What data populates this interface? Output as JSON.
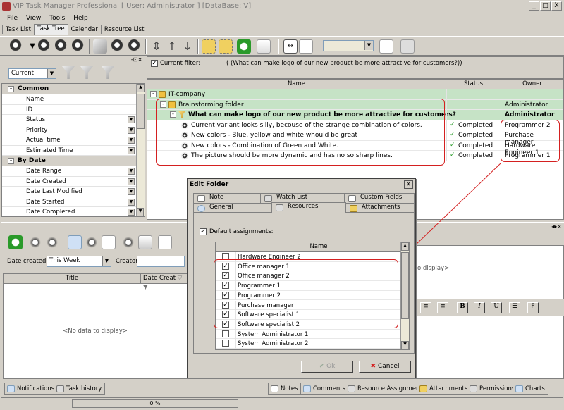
{
  "window": {
    "title": "VIP Task Manager Professional [ User: Administrator ] [DataBase: V]",
    "min": "_",
    "max": "□",
    "close": "X"
  },
  "menu": [
    "File",
    "View",
    "Tools",
    "Help"
  ],
  "tabs": [
    "Task List",
    "Task Tree",
    "Calendar",
    "Resource List"
  ],
  "left_panel": {
    "filter_value": "Current",
    "groups": [
      {
        "name": "Common",
        "toggle": "-",
        "rows": [
          {
            "label": "Name",
            "dropdown": false
          },
          {
            "label": "ID",
            "dropdown": false
          },
          {
            "label": "Status",
            "dropdown": true
          },
          {
            "label": "Priority",
            "dropdown": true
          },
          {
            "label": "Actual time",
            "dropdown": true
          },
          {
            "label": "Estimated Time",
            "dropdown": true
          }
        ]
      },
      {
        "name": "By Date",
        "toggle": "-",
        "rows": [
          {
            "label": "Date Range",
            "dropdown": true
          },
          {
            "label": "Date Created",
            "dropdown": true
          },
          {
            "label": "Date Last Modified",
            "dropdown": true
          },
          {
            "label": "Date Started",
            "dropdown": true
          },
          {
            "label": "Date Completed",
            "dropdown": true
          }
        ]
      }
    ]
  },
  "filter_bar": {
    "label": "Current filter:",
    "value": "( (What can make logo of our new product be more attractive for customers?))"
  },
  "tree": {
    "headers": {
      "name": "Name",
      "status": "Status",
      "owner": "Owner"
    },
    "rows": [
      {
        "name": "IT-company",
        "status": "",
        "owner": ""
      },
      {
        "name": "Brainstorming folder",
        "status": "",
        "owner": "Administrator"
      },
      {
        "name": "What can make logo of our new product be more attractive for customers?",
        "status": "",
        "owner": "Administrator"
      },
      {
        "name": "Current variant looks silly, becouse of the strange combination of colors.",
        "status": "Completed",
        "owner": "Programmer 2"
      },
      {
        "name": "New colors - Blue, yellow and white whould be great",
        "status": "Completed",
        "owner": "Purchase manager"
      },
      {
        "name": "New colors - Combination of Green and White.",
        "status": "Completed",
        "owner": "Hardware Engineer 1"
      },
      {
        "name": "The picture should be more dynamic and has no so sharp lines.",
        "status": "Completed",
        "owner": "Programmer 1"
      }
    ]
  },
  "lower_left": {
    "date_created_label": "Date created:",
    "date_created_value": "This Week",
    "creator_label": "Creator:",
    "col_title": "Title",
    "col_date": "Date Creat",
    "empty": "<No data to display>"
  },
  "lower_right": {
    "empty_partial": "o display>"
  },
  "dialog": {
    "title": "Edit Folder",
    "close": "X",
    "tabs_row1": [
      "Note",
      "Watch List",
      "Custom Fields"
    ],
    "tabs_row2": [
      "General",
      "Resources",
      "Attachments"
    ],
    "default_assignments": "Default assignments:",
    "list_header": "Name",
    "resources": [
      {
        "name": "Hardware Engineer 2",
        "checked": false
      },
      {
        "name": "Office manager 1",
        "checked": true
      },
      {
        "name": "Office manager 2",
        "checked": true
      },
      {
        "name": "Programmer 1",
        "checked": true
      },
      {
        "name": "Programmer 2",
        "checked": true
      },
      {
        "name": "Purchase manager",
        "checked": true
      },
      {
        "name": "Software specialist 1",
        "checked": true
      },
      {
        "name": "Software specialist 2",
        "checked": true
      },
      {
        "name": "System Administrator 1",
        "checked": false
      },
      {
        "name": "System Administrator 2",
        "checked": false
      }
    ],
    "ok": "Ok",
    "cancel": "Cancel"
  },
  "bottom_tabs_left": [
    "Notifications",
    "Task history"
  ],
  "bottom_tabs_right": [
    "Notes",
    "Comments",
    "Resource Assignment",
    "Attachments",
    "Permissions",
    "Charts"
  ],
  "status": {
    "progress": "0 %"
  },
  "colors": {
    "highlight_green": "#c6e3c6",
    "annotation_red": "#d42020",
    "window_bg": "#d4d0c8"
  }
}
